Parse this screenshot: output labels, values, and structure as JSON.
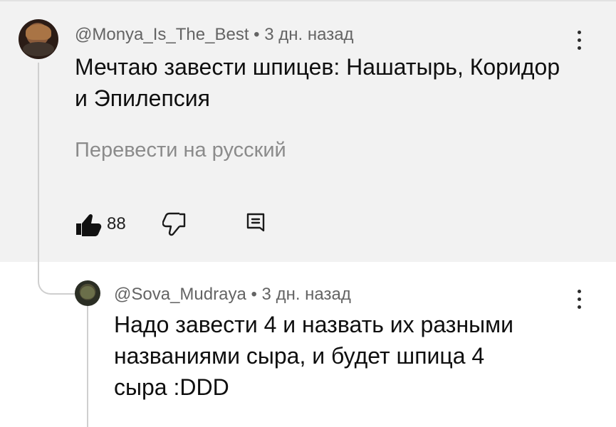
{
  "comments": {
    "parent": {
      "author": "@Monya_Is_The_Best",
      "separator": "•",
      "time": "3 дн. назад",
      "text_line_1": "Мечтаю завести шпицев: Нашатырь, Коридор",
      "text_line_2": "и Эпилепсия",
      "translate_label": "Перевести на русский",
      "likes": "88"
    },
    "reply": {
      "author": "@Sova_Mudraya",
      "separator": "•",
      "time": "3 дн. назад",
      "text_line_1": "Надо завести 4 и назвать их разными",
      "text_line_2": "названиями сыра, и будет шпица 4",
      "text_line_3": "сыра :DDD"
    }
  },
  "icons": {
    "avatar": "avatar",
    "menu": "more-vert-icon",
    "like": "thumb-up-icon",
    "dislike": "thumb-down-icon",
    "reply": "reply-icon"
  },
  "colors": {
    "parent_background": "#f2f2f2",
    "primary_text": "#0f0f0f",
    "secondary_text": "#646464",
    "translate_text": "#8b8b8b",
    "thread_line": "#cfcfcf"
  }
}
